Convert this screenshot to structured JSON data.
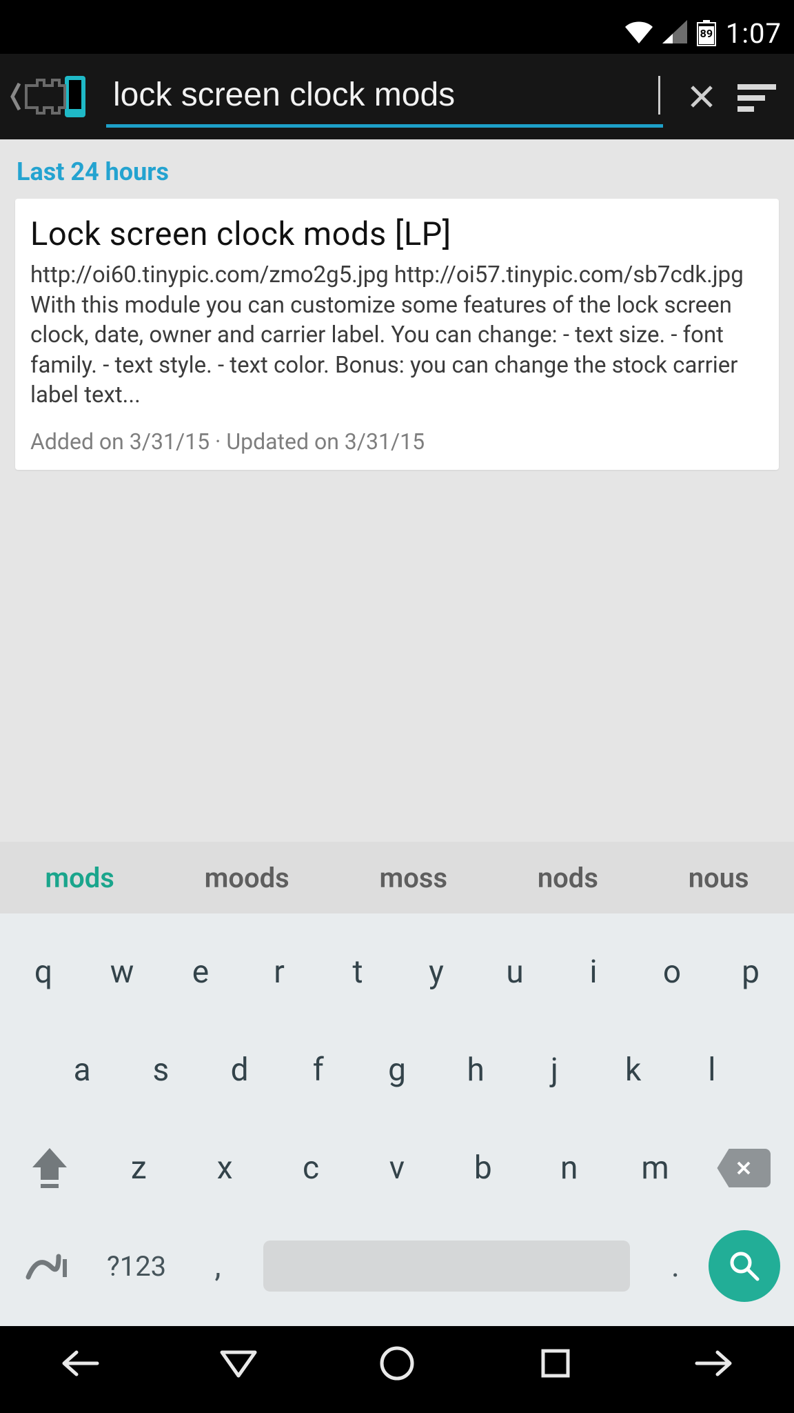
{
  "status": {
    "battery": "89",
    "time": "1:07"
  },
  "appbar": {
    "searchValue": "lock screen clock mods"
  },
  "filter": {
    "label": "Last 24 hours"
  },
  "result": {
    "title": "Lock screen clock mods [LP]",
    "description": "http://oi60.tinypic.com/zmo2g5.jpg http://oi57.tinypic.com/sb7cdk.jpg With this module you can customize some features of the lock screen clock, date, owner and carrier label. You can change: - text size. - font family. - text style. - text color. Bonus: you can change the stock carrier label text...",
    "meta": "Added on 3/31/15 · Updated on 3/31/15"
  },
  "suggestions": [
    "mods",
    "moods",
    "moss",
    "nods",
    "nous"
  ],
  "keyboard": {
    "row1": [
      "q",
      "w",
      "e",
      "r",
      "t",
      "y",
      "u",
      "i",
      "o",
      "p"
    ],
    "row2": [
      "a",
      "s",
      "d",
      "f",
      "g",
      "h",
      "j",
      "k",
      "l"
    ],
    "row3": [
      "z",
      "x",
      "c",
      "v",
      "b",
      "n",
      "m"
    ],
    "numLabel": "?123",
    "comma": ",",
    "dot": "."
  }
}
